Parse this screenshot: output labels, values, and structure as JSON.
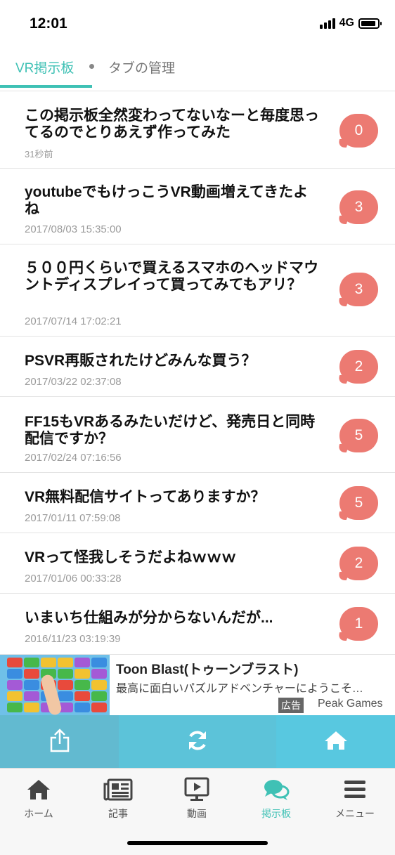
{
  "status_bar": {
    "time": "12:01",
    "network": "4G",
    "battery_level": 0.9,
    "signal_bars": 4
  },
  "tabs": {
    "active_label": "VR掲示板",
    "manage_label": "タブの管理"
  },
  "threads": [
    {
      "title": "この掲示板全然変わってないなーと毎度思ってるのでとりあえず作ってみた",
      "date": "31秒前",
      "count": "0"
    },
    {
      "title": "youtubeでもけっこうVR動画増えてきたよね",
      "date": "2017/08/03 15:35:00",
      "count": "3"
    },
    {
      "title": "５００円くらいで買えるスマホのヘッドマウントディスプレイって買ってみてもアリ？",
      "date": "2017/07/14 17:02:21",
      "count": "3"
    },
    {
      "title": "PSVR再販されたけどみんな買う？",
      "date": "2017/03/22 02:37:08",
      "count": "2"
    },
    {
      "title": "FF15もVRあるみたいだけど、発売日と同時配信ですか？",
      "date": "2017/02/24 07:16:56",
      "count": "5"
    },
    {
      "title": "VR無料配信サイトってありますか？",
      "date": "2017/01/11 07:59:08",
      "count": "5"
    },
    {
      "title": "VRって怪我しそうだよねｗｗｗ",
      "date": "2017/01/06 00:33:28",
      "count": "2"
    },
    {
      "title": "いまいち仕組みが分からないんだが...",
      "date": "2016/11/23 03:19:39",
      "count": "1"
    }
  ],
  "ad": {
    "title": "Toon Blast(トゥーンブラスト)",
    "description": "最高に面白いパズルアドベンチャーにようこそ…",
    "badge": "広告",
    "advertiser": "Peak Games"
  },
  "action_bar": {
    "share_icon": "share-icon",
    "reload_icon": "reload-icon",
    "home_icon": "home-icon"
  },
  "tabbar": {
    "items": [
      {
        "label": "ホーム",
        "icon": "home-icon"
      },
      {
        "label": "記事",
        "icon": "newspaper-icon"
      },
      {
        "label": "動画",
        "icon": "video-icon"
      },
      {
        "label": "掲示板",
        "icon": "chat-bubbles-icon"
      },
      {
        "label": "メニュー",
        "icon": "hamburger-menu-icon"
      }
    ],
    "active_index": 3
  },
  "colors": {
    "accent": "#3fc1b5",
    "bubble": "#ec7a72",
    "action_bar": "#5bc6dc"
  }
}
